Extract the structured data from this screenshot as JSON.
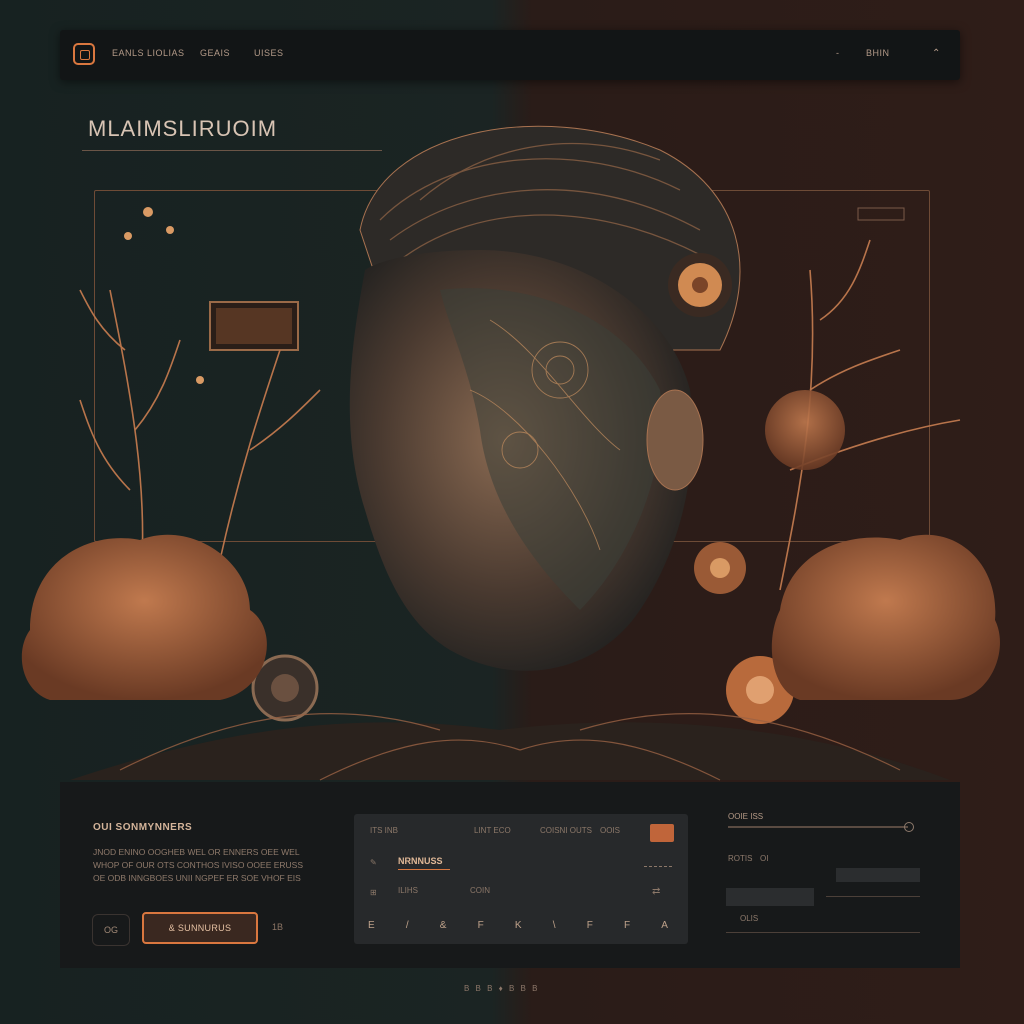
{
  "header": {
    "nav_items": [
      "EANLS LIOLIAS",
      "GEAIS",
      "UISES"
    ],
    "right_short": "-",
    "right_link": "BHIN",
    "right_icon": "chevron-up-icon"
  },
  "hero": {
    "title": "MLAIMSLIRUOIM"
  },
  "info": {
    "section_title": "OUI SONMYNNERS",
    "paragraph": "JNOD ENINO OOGHEB WEL OR ENNERS OEE WEL WHOP OF OUR OTS CONTHOS IVISO OOEE ERUSS OE ODB INNGBOES UNII NGPEF ER SOE VHOF EIS",
    "ghost_button": "OG",
    "cta_button": "& SUNNURUS",
    "extra_link": "1B"
  },
  "panel": {
    "col1": "ITS INB",
    "col2": "LINT ECO",
    "col3": "COISNI OUTS",
    "col4": "OOIS",
    "headline": "NRNNUSS",
    "sub1": "ILIHS",
    "sub2": "COIN",
    "toolbar": [
      "E",
      "/",
      "&",
      "F",
      "K",
      "\\",
      "F",
      "F",
      "A"
    ]
  },
  "right_panel": {
    "label": "OOIE ISS",
    "row1": "ROTIS",
    "row1b": "OI",
    "row2": "OLIS"
  },
  "footer": {
    "text": "B B B ♦ B B B"
  },
  "colors": {
    "accent": "#d9773f",
    "copper": "#b8744b",
    "bg_left": "#172221",
    "bg_right": "#2f1d18"
  }
}
